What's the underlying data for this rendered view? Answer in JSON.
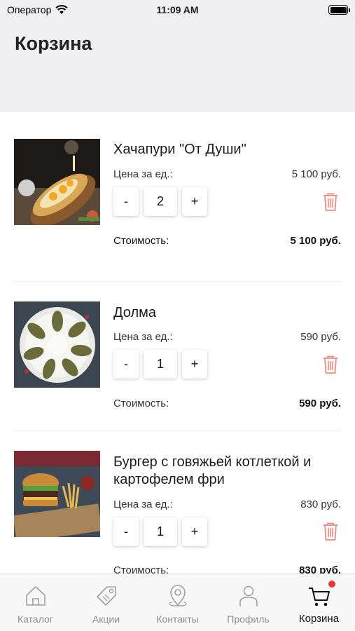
{
  "status_bar": {
    "carrier": "Оператор",
    "time": "11:09 AM"
  },
  "header": {
    "title": "Корзина"
  },
  "cart": {
    "items": [
      {
        "name": "Хачапури \"От Души\"",
        "unit_price_label": "Цена за ед.:",
        "unit_price": "5 100 руб.",
        "qty_minus": "-",
        "quantity": "2",
        "qty_plus": "+",
        "total_label": "Стоимость:",
        "total": "5 100 руб."
      },
      {
        "name": "Долма",
        "unit_price_label": "Цена за ед.:",
        "unit_price": "590 руб.",
        "qty_minus": "-",
        "quantity": "1",
        "qty_plus": "+",
        "total_label": "Стоимость:",
        "total": "590 руб."
      },
      {
        "name": "Бургер с говяжьей котлеткой и картофелем фри",
        "unit_price_label": "Цена за ед.:",
        "unit_price": "830 руб.",
        "qty_minus": "-",
        "quantity": "1",
        "qty_plus": "+",
        "total_label": "Стоимость:",
        "total": "830 руб."
      }
    ]
  },
  "tab_bar": {
    "tabs": [
      {
        "label": "Каталог",
        "icon": "home-icon"
      },
      {
        "label": "Акции",
        "icon": "tag-icon"
      },
      {
        "label": "Контакты",
        "icon": "location-pin-icon"
      },
      {
        "label": "Профиль",
        "icon": "person-icon"
      },
      {
        "label": "Корзина",
        "icon": "cart-icon",
        "active": true,
        "badge": "red-dot"
      }
    ]
  },
  "colors": {
    "header_bg": "#efeff4",
    "trash": "#f08a80",
    "badge": "#e53935",
    "tab_inactive": "#8e8e93"
  }
}
